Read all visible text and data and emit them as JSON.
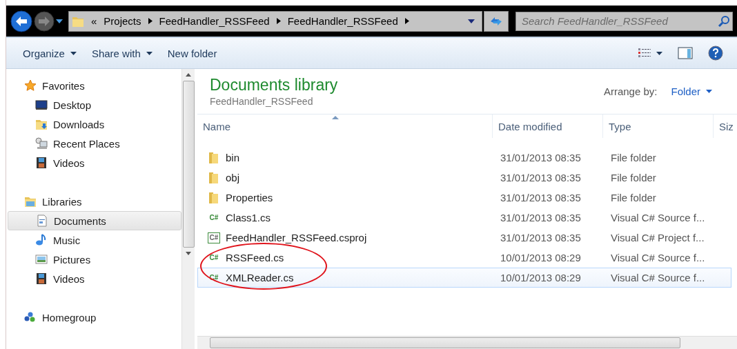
{
  "address_bar": {
    "overflow": "«",
    "crumbs": [
      "Projects",
      "FeedHandler_RSSFeed",
      "FeedHandler_RSSFeed"
    ]
  },
  "search": {
    "placeholder": "Search FeedHandler_RSSFeed"
  },
  "toolbar": {
    "buttons": [
      {
        "label": "Organize",
        "dropdown": true
      },
      {
        "label": "Share with",
        "dropdown": true
      },
      {
        "label": "New folder",
        "dropdown": false
      }
    ]
  },
  "sidebar": {
    "groups": [
      {
        "label": "Favorites",
        "kind": "favorites",
        "children": [
          {
            "label": "Desktop",
            "kind": "desktop",
            "selected": false
          },
          {
            "label": "Downloads",
            "kind": "downloads",
            "selected": false
          },
          {
            "label": "Recent Places",
            "kind": "recent",
            "selected": false
          },
          {
            "label": "Videos",
            "kind": "videos",
            "selected": false
          }
        ]
      },
      {
        "label": "Libraries",
        "kind": "libraries",
        "children": [
          {
            "label": "Documents",
            "kind": "documents",
            "selected": true
          },
          {
            "label": "Music",
            "kind": "music",
            "selected": false
          },
          {
            "label": "Pictures",
            "kind": "pictures",
            "selected": false
          },
          {
            "label": "Videos",
            "kind": "videos",
            "selected": false
          }
        ]
      },
      {
        "label": "Homegroup",
        "kind": "homegroup"
      }
    ]
  },
  "library": {
    "title": "Documents library",
    "subtitle": "FeedHandler_RSSFeed",
    "arrange_label": "Arrange by:",
    "arrange_value": "Folder"
  },
  "table": {
    "columns": [
      "Name",
      "Date modified",
      "Type",
      "Siz"
    ],
    "rows": [
      {
        "kind": "folder",
        "name": "bin",
        "date": "31/01/2013 08:35",
        "type": "File folder",
        "selected": false
      },
      {
        "kind": "folder",
        "name": "obj",
        "date": "31/01/2013 08:35",
        "type": "File folder",
        "selected": false
      },
      {
        "kind": "folder",
        "name": "Properties",
        "date": "31/01/2013 08:35",
        "type": "File folder",
        "selected": false
      },
      {
        "kind": "cs",
        "icon": "C#",
        "name": "Class1.cs",
        "date": "31/01/2013 08:35",
        "type": "Visual C# Source f...",
        "selected": false
      },
      {
        "kind": "csproj",
        "icon": "C#",
        "name": "FeedHandler_RSSFeed.csproj",
        "date": "31/01/2013 08:35",
        "type": "Visual C# Project f...",
        "selected": false
      },
      {
        "kind": "cs",
        "icon": "C#",
        "name": "RSSFeed.cs",
        "date": "10/01/2013 08:29",
        "type": "Visual C# Source f...",
        "selected": false
      },
      {
        "kind": "cs",
        "icon": "C#",
        "name": "XMLReader.cs",
        "date": "10/01/2013 08:29",
        "type": "Visual C# Source f...",
        "selected": true
      }
    ]
  }
}
